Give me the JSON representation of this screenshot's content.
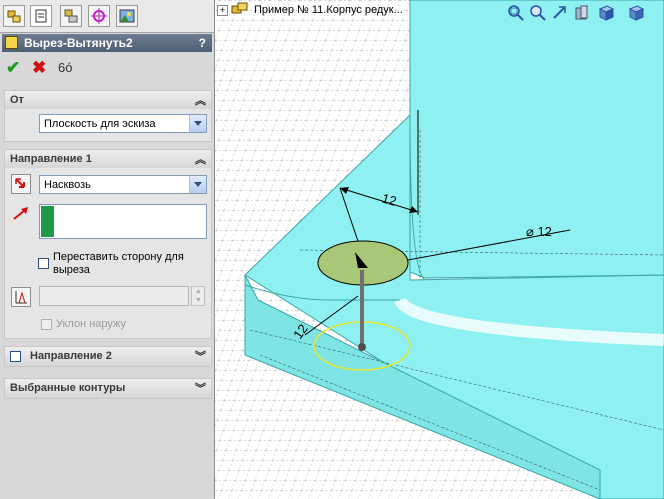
{
  "property_manager": {
    "tabs": [
      "featuremanager-tab",
      "propertymanager-tab",
      "configurationmanager-tab",
      "dimxpert-tab",
      "display-manager-tab"
    ],
    "title": "Вырез-Вытянуть2",
    "help_label": "?",
    "actions": {
      "ok": "✔",
      "cancel": "✖",
      "preview": "6ó"
    },
    "from_group": {
      "title": "От",
      "start_condition": "Плоскость для эскиза"
    },
    "direction1_group": {
      "title": "Направление 1",
      "end_condition": "Насквозь",
      "flip_side_label_line1": "Переставить сторону для",
      "flip_side_label_line2": "выреза",
      "draft_outward_label": "Уклон наружу"
    },
    "direction2_group": {
      "title": "Направление 2"
    },
    "selected_contours_group": {
      "title": "Выбранные контуры"
    }
  },
  "viewport": {
    "tree_root_label": "Пример № 11.Корпус редук...",
    "tree_expand": "+",
    "dimensions": {
      "depth1": "12",
      "diameter": "⌀ 12",
      "depth2": "12"
    }
  },
  "colors": {
    "model_face": "#8ef0f0",
    "model_edge": "#3aa6a6",
    "sketch_fill": "#a8c878",
    "preview_ring": "#e8e830",
    "title_bar": "#4f5d72",
    "ok_green": "#1f9b1f",
    "cancel_red": "#d01010"
  }
}
